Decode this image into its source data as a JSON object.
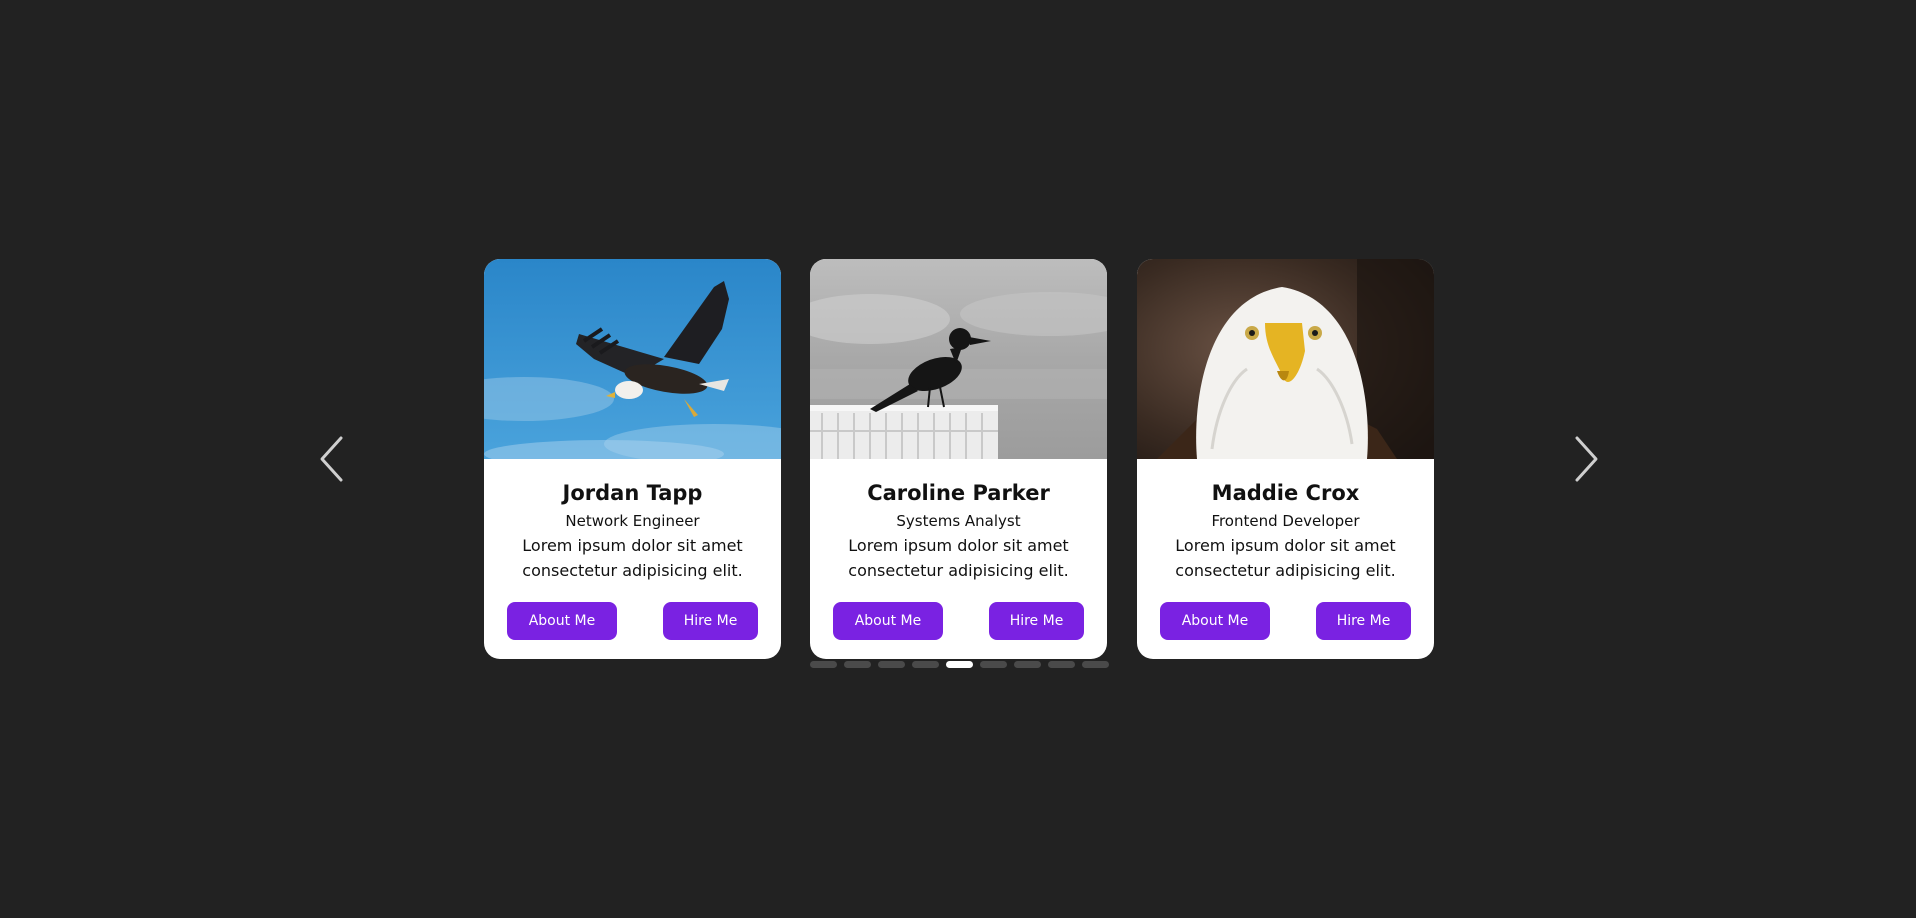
{
  "carousel": {
    "prev_icon": "chevron-left-icon",
    "next_icon": "chevron-right-icon",
    "cards": [
      {
        "name": "Jordan Tapp",
        "role": "Network Engineer",
        "description": "Lorem ipsum dolor sit amet consectetur adipisicing elit.",
        "about_label": "About Me",
        "hire_label": "Hire Me",
        "image": "bald-eagle-flying-blue-sky"
      },
      {
        "name": "Caroline Parker",
        "role": "Systems Analyst",
        "description": "Lorem ipsum dolor sit amet consectetur adipisicing elit.",
        "about_label": "About Me",
        "hire_label": "Hire Me",
        "image": "crow-on-fence-grayscale"
      },
      {
        "name": "Maddie Crox",
        "role": "Frontend Developer",
        "description": "Lorem ipsum dolor sit amet consectetur adipisicing elit.",
        "about_label": "About Me",
        "hire_label": "Hire Me",
        "image": "bald-eagle-portrait"
      }
    ],
    "pagination": {
      "total": 9,
      "active_index": 4
    }
  },
  "colors": {
    "background": "#222222",
    "accent": "#7a22e2",
    "card": "#ffffff",
    "dot_inactive": "#4a4a4a",
    "dot_active": "#ffffff"
  }
}
